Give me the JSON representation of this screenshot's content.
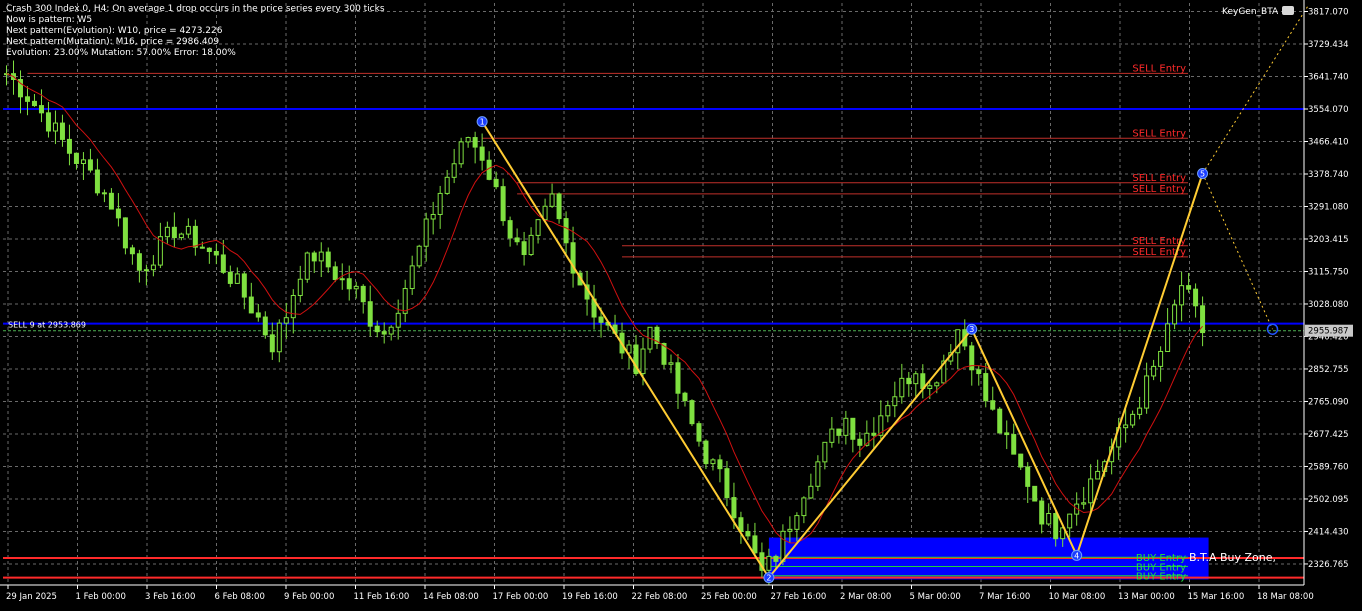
{
  "header": {
    "lines": [
      "Crash 300 Index.0, H4:  On average 1 drop occurs in the price series every 300 ticks",
      "Now is pattern: W5",
      "Next pattern(Evolution): W10, price = 4273.226",
      "Next pattern(Mutation): M16, price = 2986.409",
      "Evolution: 23.00% Mutation: 57.00% Error: 18.00%"
    ],
    "keygen": "KeyGen_BTA"
  },
  "chart_data": {
    "type": "candlestick",
    "symbol": "Crash 300 Index.0",
    "timeframe": "H4",
    "ylim": [
      2270,
      3840
    ],
    "price_ticks": [
      "3817.070",
      "3729.434",
      "3641.740",
      "3554.070",
      "3466.410",
      "3378.740",
      "3291.080",
      "3203.415",
      "3115.750",
      "3028.080",
      "2940.420",
      "2852.755",
      "2765.090",
      "2677.425",
      "2589.760",
      "2502.095",
      "2414.430",
      "2326.765"
    ],
    "date_ticks": [
      "29 Jan 2025",
      "1 Feb 00:00",
      "3 Feb 16:00",
      "6 Feb 08:00",
      "9 Feb 00:00",
      "11 Feb 16:00",
      "14 Feb 08:00",
      "17 Feb 00:00",
      "19 Feb 16:00",
      "22 Feb 08:00",
      "25 Feb 00:00",
      "27 Feb 16:00",
      "2 Mar 08:00",
      "5 Mar 00:00",
      "7 Mar 16:00",
      "10 Mar 08:00",
      "13 Mar 00:00",
      "15 Mar 16:00",
      "18 Mar 08:00"
    ],
    "current_price": "2955.987",
    "price_path": [
      [
        0,
        3650
      ],
      [
        3,
        3590
      ],
      [
        6,
        3520
      ],
      [
        9,
        3440
      ],
      [
        12,
        3380
      ],
      [
        15,
        3300
      ],
      [
        17,
        3200
      ],
      [
        19,
        3120
      ],
      [
        21,
        3160
      ],
      [
        24,
        3230
      ],
      [
        27,
        3200
      ],
      [
        30,
        3150
      ],
      [
        33,
        3080
      ],
      [
        36,
        2990
      ],
      [
        38,
        2920
      ],
      [
        40,
        3000
      ],
      [
        42,
        3120
      ],
      [
        44,
        3160
      ],
      [
        46,
        3130
      ],
      [
        48,
        3090
      ],
      [
        50,
        3060
      ],
      [
        52,
        2990
      ],
      [
        54,
        2950
      ],
      [
        56,
        3030
      ],
      [
        58,
        3120
      ],
      [
        60,
        3230
      ],
      [
        62,
        3330
      ],
      [
        64,
        3410
      ],
      [
        66,
        3480
      ],
      [
        68,
        3430
      ],
      [
        70,
        3330
      ],
      [
        72,
        3220
      ],
      [
        74,
        3140
      ],
      [
        76,
        3230
      ],
      [
        78,
        3310
      ],
      [
        80,
        3190
      ],
      [
        82,
        3090
      ],
      [
        84,
        3010
      ],
      [
        86,
        2960
      ],
      [
        88,
        2910
      ],
      [
        90,
        2870
      ],
      [
        92,
        2960
      ],
      [
        94,
        2890
      ],
      [
        96,
        2790
      ],
      [
        98,
        2700
      ],
      [
        100,
        2620
      ],
      [
        102,
        2560
      ],
      [
        104,
        2480
      ],
      [
        106,
        2390
      ],
      [
        108,
        2300
      ],
      [
        110,
        2350
      ],
      [
        112,
        2440
      ],
      [
        114,
        2530
      ],
      [
        116,
        2600
      ],
      [
        118,
        2670
      ],
      [
        120,
        2720
      ],
      [
        122,
        2660
      ],
      [
        124,
        2700
      ],
      [
        126,
        2770
      ],
      [
        128,
        2810
      ],
      [
        130,
        2860
      ],
      [
        132,
        2800
      ],
      [
        134,
        2880
      ],
      [
        136,
        2960
      ],
      [
        138,
        2880
      ],
      [
        140,
        2770
      ],
      [
        142,
        2690
      ],
      [
        144,
        2610
      ],
      [
        146,
        2550
      ],
      [
        148,
        2460
      ],
      [
        150,
        2420
      ],
      [
        152,
        2480
      ],
      [
        154,
        2520
      ],
      [
        156,
        2580
      ],
      [
        158,
        2640
      ],
      [
        160,
        2700
      ],
      [
        162,
        2770
      ],
      [
        164,
        2850
      ],
      [
        166,
        2950
      ],
      [
        168,
        3080
      ],
      [
        170,
        3000
      ],
      [
        171,
        2955.987
      ]
    ],
    "zigzag": [
      [
        68,
        3520
      ],
      [
        109,
        2290
      ],
      [
        138,
        2960
      ],
      [
        153,
        2350
      ],
      [
        171,
        3380
      ]
    ],
    "projection": [
      [
        171,
        3380
      ],
      [
        181,
        2960
      ]
    ],
    "projection_up": [
      [
        171,
        3380
      ],
      [
        186,
        3830
      ]
    ],
    "horizontal_levels": [
      {
        "price": 3554.07,
        "color": "#0000ff"
      },
      {
        "price": 2975.0,
        "color": "#0000ff"
      },
      {
        "price": 2955.987,
        "color": "#4caf50",
        "dashed": true
      }
    ],
    "sell_entries": [
      3650,
      3475,
      3355,
      3325,
      3185,
      3155
    ],
    "buy_entries": [
      2345,
      2320,
      2295
    ],
    "buy_zone": {
      "top": 2398,
      "bottom": 2285
    },
    "red_support": [
      2343,
      2290
    ],
    "sell_label": "SELL 9 at 2953.869",
    "buy_zone_label": "B.T.A  Buy Zone,",
    "sell_entry_text": "SELL Entry",
    "buy_entry_text": "BUY Entry",
    "pivot_labels": [
      "1",
      "2",
      "3",
      "4",
      "5"
    ]
  }
}
